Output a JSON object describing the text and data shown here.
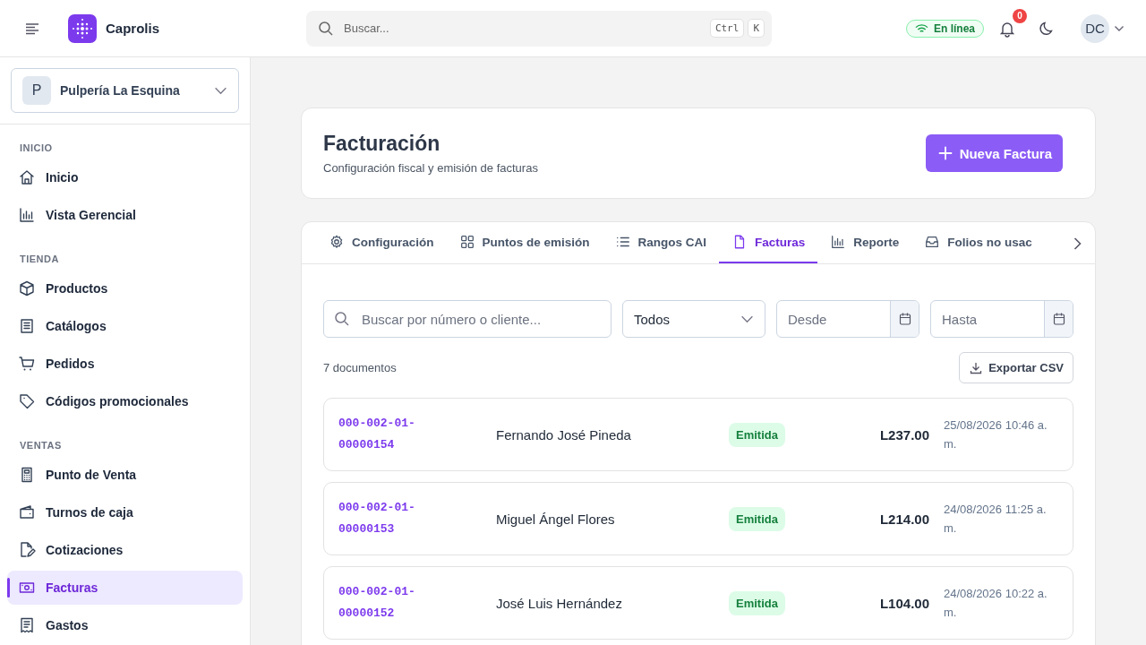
{
  "app": {
    "name": "Caprolis"
  },
  "search": {
    "placeholder": "Buscar...",
    "keys": [
      "Ctrl",
      "K"
    ]
  },
  "status": {
    "label": "En línea"
  },
  "notifications": {
    "count": "0"
  },
  "user": {
    "initials": "DC"
  },
  "store": {
    "initial": "P",
    "name": "Pulpería La Esquina"
  },
  "sidebar": {
    "sections": [
      {
        "title": "INICIO",
        "items": [
          {
            "label": "Inicio",
            "selected": false
          },
          {
            "label": "Vista Gerencial",
            "selected": false
          }
        ]
      },
      {
        "title": "TIENDA",
        "items": [
          {
            "label": "Productos",
            "selected": false
          },
          {
            "label": "Catálogos",
            "selected": false
          },
          {
            "label": "Pedidos",
            "selected": false
          },
          {
            "label": "Códigos promocionales",
            "selected": false
          }
        ]
      },
      {
        "title": "VENTAS",
        "items": [
          {
            "label": "Punto de Venta",
            "selected": false
          },
          {
            "label": "Turnos de caja",
            "selected": false
          },
          {
            "label": "Cotizaciones",
            "selected": false
          },
          {
            "label": "Facturas",
            "selected": true
          },
          {
            "label": "Gastos",
            "selected": false
          }
        ]
      }
    ]
  },
  "page": {
    "title": "Facturación",
    "subtitle": "Configuración fiscal y emisión de facturas",
    "action": "Nueva Factura"
  },
  "tabs": [
    {
      "label": "Configuración",
      "selected": false
    },
    {
      "label": "Puntos de emisión",
      "selected": false
    },
    {
      "label": "Rangos CAI",
      "selected": false
    },
    {
      "label": "Facturas",
      "selected": true
    },
    {
      "label": "Reporte",
      "selected": false
    },
    {
      "label": "Folios no usac",
      "selected": false
    }
  ],
  "filters": {
    "search_placeholder": "Buscar por número o cliente...",
    "status": "Todos",
    "from_placeholder": "Desde",
    "to_placeholder": "Hasta"
  },
  "count": "7 documentos",
  "export": "Exportar CSV",
  "invoices": [
    {
      "number": "000-002-01-00000154",
      "customer": "Fernando José Pineda",
      "status": "Emitida",
      "amount": "L237.00",
      "date": "25/08/2026 10:46 a. m."
    },
    {
      "number": "000-002-01-00000153",
      "customer": "Miguel Ángel Flores",
      "status": "Emitida",
      "amount": "L214.00",
      "date": "24/08/2026 11:25 a. m."
    },
    {
      "number": "000-002-01-00000152",
      "customer": "José Luis Hernández",
      "status": "Emitida",
      "amount": "L104.00",
      "date": "24/08/2026 10:22 a. m."
    }
  ]
}
